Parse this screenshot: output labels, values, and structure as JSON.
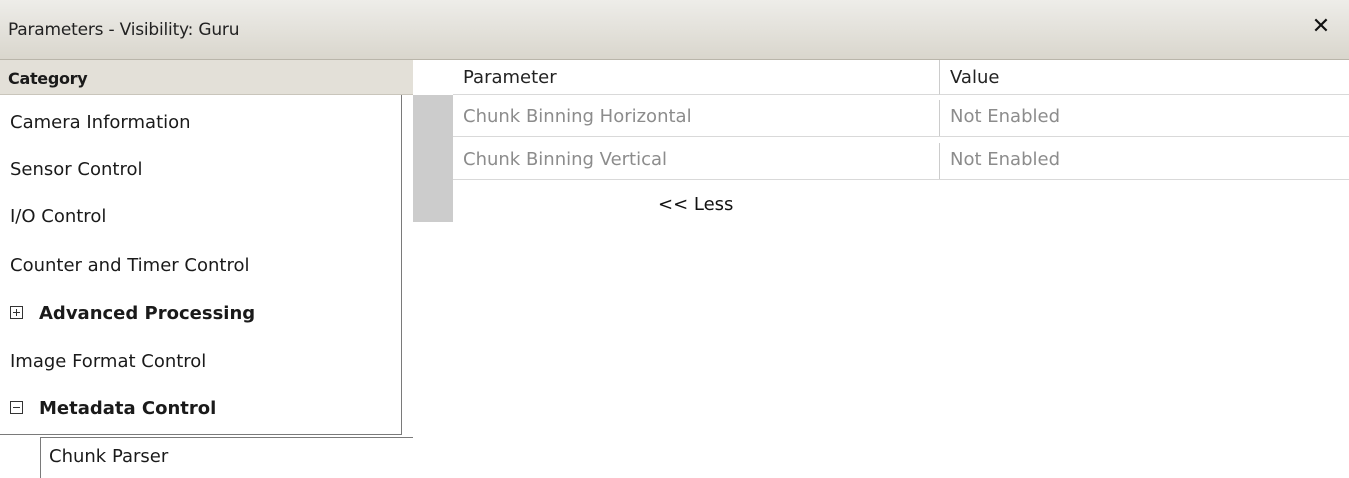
{
  "window": {
    "title": "Parameters - Visibility: Guru",
    "close_glyph": "✕"
  },
  "category_panel": {
    "header": "Category",
    "items": [
      {
        "label": "Camera Information",
        "bold": false
      },
      {
        "label": "Sensor Control",
        "bold": false
      },
      {
        "label": "I/O Control",
        "bold": false
      },
      {
        "label": "Counter and Timer Control",
        "bold": false
      },
      {
        "label": "Advanced Processing",
        "bold": true,
        "expander": "plus-box-icon"
      },
      {
        "label": "Image Format Control",
        "bold": false
      },
      {
        "label": "Metadata Control",
        "bold": true,
        "expander": "minus-box-icon"
      }
    ],
    "sub_item": "Chunk Parser"
  },
  "grid": {
    "columns": {
      "parameter": "Parameter",
      "value": "Value"
    },
    "rows": [
      {
        "parameter": "Chunk Binning Horizontal",
        "value": "Not Enabled"
      },
      {
        "parameter": "Chunk Binning Vertical",
        "value": "Not Enabled"
      }
    ],
    "less_link": "<< Less"
  },
  "colors": {
    "titlebar": "#d9d6cd",
    "category_header": "#e3e0d8",
    "disabled_text": "#8c8c8c",
    "scroll_indicator": "#cccccc"
  }
}
